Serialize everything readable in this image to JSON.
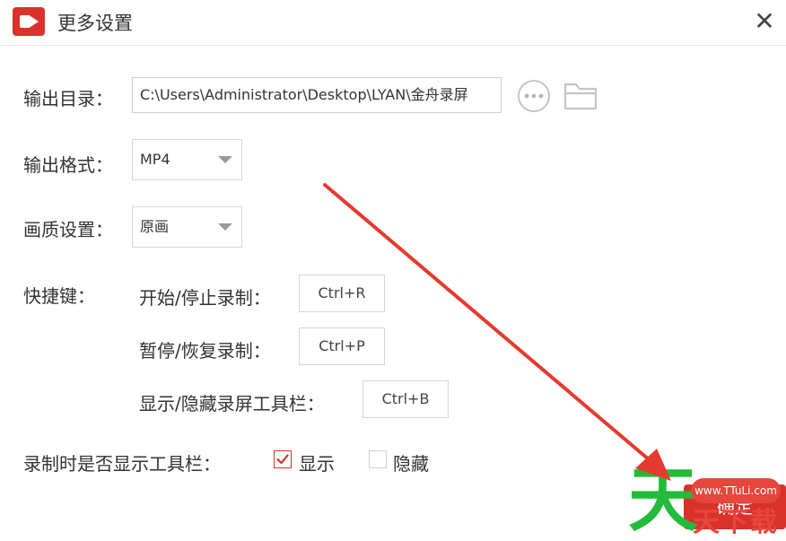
{
  "window": {
    "title": "更多设置",
    "close_glyph": "✕"
  },
  "output_dir": {
    "label": "输出目录：",
    "value": "C:\\Users\\Administrator\\Desktop\\LYAN\\金舟录屏"
  },
  "output_format": {
    "label": "输出格式：",
    "value": "MP4"
  },
  "quality": {
    "label": "画质设置：",
    "value": "原画"
  },
  "hotkeys": {
    "label": "快捷键：",
    "items": [
      {
        "label": "开始/停止录制：",
        "key": "Ctrl+R"
      },
      {
        "label": "暂停/恢复录制：",
        "key": "Ctrl+P"
      },
      {
        "label": "显示/隐藏录屏工具栏：",
        "key": "Ctrl+B"
      }
    ]
  },
  "toolbar_display": {
    "label": "录制时是否显示工具栏：",
    "options": [
      {
        "label": "显示",
        "checked": true
      },
      {
        "label": "隐藏",
        "checked": false
      }
    ]
  },
  "confirm_label": "确定",
  "watermark": {
    "pill_text": "www.TTuLi.com",
    "big_char": "天",
    "small_text": "天下载"
  },
  "colors": {
    "accent": "#d9322b",
    "annotation_arrow": "#e53a2f",
    "watermark_green": "#22bb3a"
  },
  "icons": [
    "app-logo-icon",
    "close-icon",
    "more-options-icon",
    "folder-icon",
    "checkbox-checked-icon",
    "checkbox-unchecked-icon",
    "dropdown-caret-icon",
    "annotation-arrow-icon"
  ]
}
